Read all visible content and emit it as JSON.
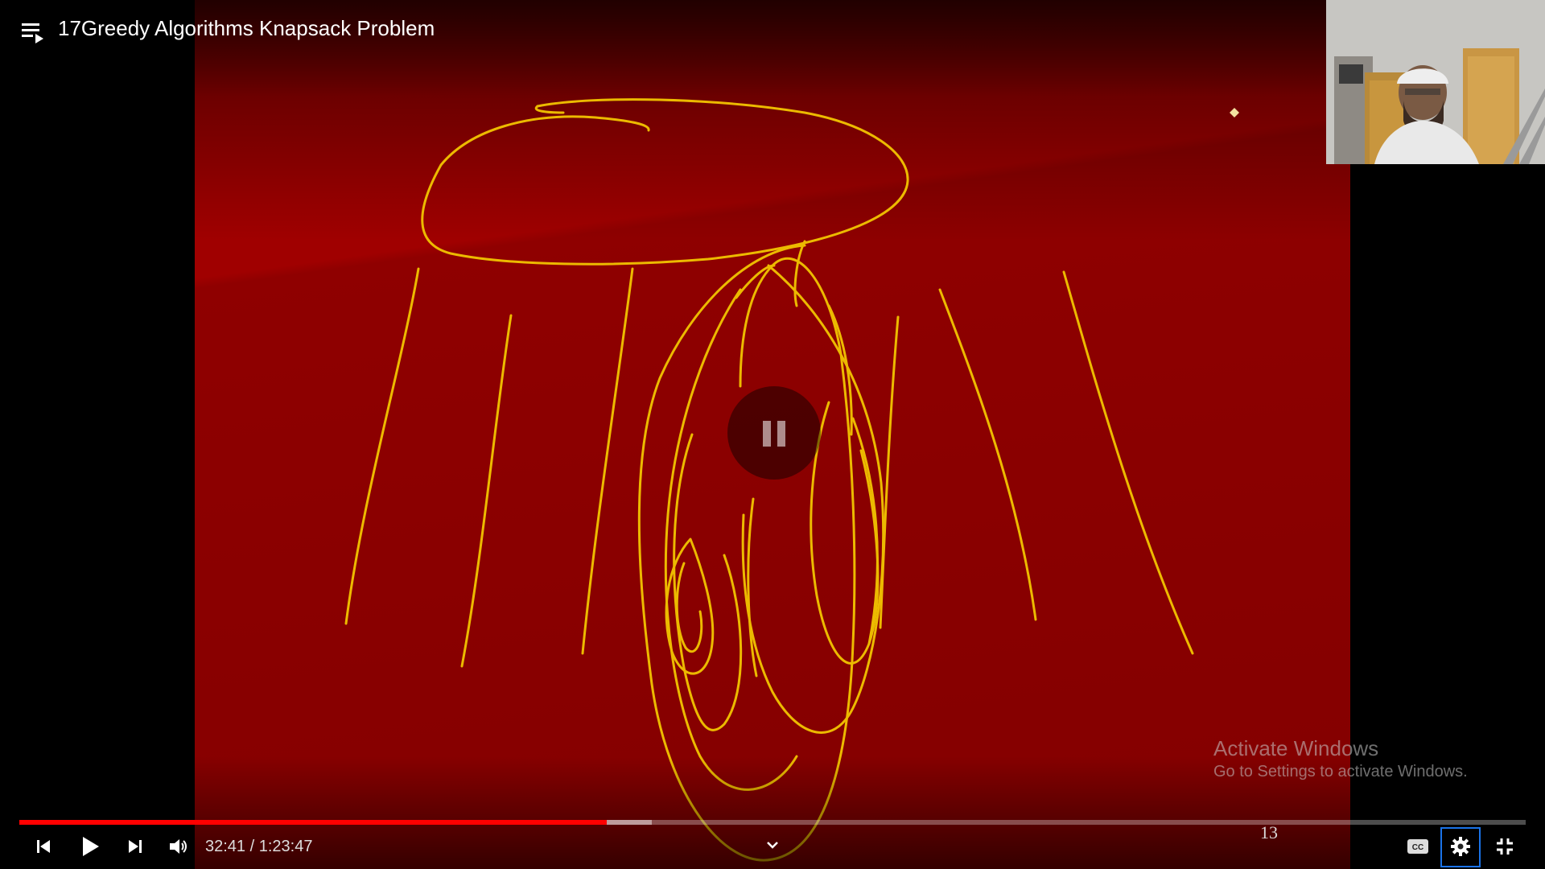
{
  "app": {
    "title": "17Greedy Algorithms Knapsack Problem"
  },
  "top_bar": {
    "playlist_icon": "playlist-icon",
    "watch_later_icon": "clock-icon",
    "share_icon": "share-arrow-icon"
  },
  "video": {
    "slide_number": "13",
    "overlay_icon": "pause-icon",
    "watermark": {
      "title": "Activate Windows",
      "subtitle": "Go to Settings to activate Windows."
    },
    "colors": {
      "slide_background": "#9a0000",
      "ink": "#f2c400"
    }
  },
  "player_controls": {
    "current_time": "32:41",
    "duration": "1:23:47",
    "time_display": "32:41 / 1:23:47",
    "progress_played_fraction": 0.39,
    "progress_buffered_fraction": 0.42,
    "progress_color": "#ff0000",
    "icons": {
      "previous": "skip-previous-icon",
      "play": "play-icon",
      "next": "skip-next-icon",
      "volume": "volume-icon",
      "chevron": "chevron-down-icon",
      "captions": "closed-captions-icon",
      "settings": "gear-icon",
      "exit_fullscreen": "exit-fullscreen-icon"
    }
  }
}
